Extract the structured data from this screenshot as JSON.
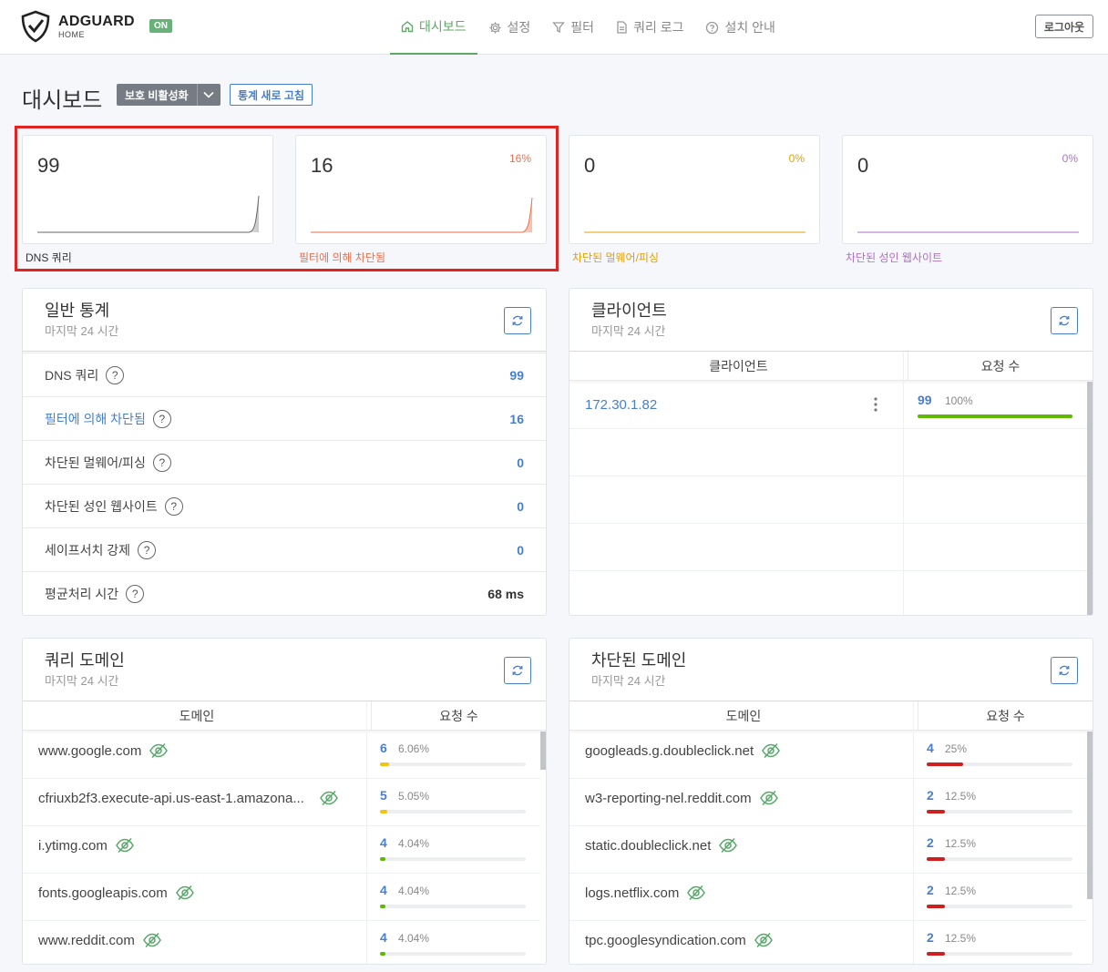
{
  "header": {
    "logo_name": "ADGUARD",
    "logo_sub": "HOME",
    "status_badge": "ON",
    "nav": [
      {
        "label": "대시보드",
        "icon": "home-icon"
      },
      {
        "label": "설정",
        "icon": "gear-icon"
      },
      {
        "label": "필터",
        "icon": "filter-icon"
      },
      {
        "label": "쿼리 로그",
        "icon": "document-icon"
      },
      {
        "label": "설치 안내",
        "icon": "help-circle-icon"
      }
    ],
    "logout": "로그아웃"
  },
  "title": {
    "text": "대시보드",
    "protect_button": "보호 비활성화",
    "refresh_stats": "통계 새로 고침"
  },
  "stats": [
    {
      "value": "99",
      "percent": "",
      "label": "DNS 쿼리",
      "color": "#666666"
    },
    {
      "value": "16",
      "percent": "16%",
      "label": "필터에 의해 차단됨",
      "color": "#ef6d4a"
    },
    {
      "value": "0",
      "percent": "0%",
      "label": "차단된 멀웨어/피싱",
      "color": "#e3a000"
    },
    {
      "value": "0",
      "percent": "0%",
      "label": "차단된 성인 웹사이트",
      "color": "#b26ec9"
    }
  ],
  "general": {
    "title": "일반 통계",
    "subtitle": "마지막 24 시간",
    "rows": [
      {
        "label": "DNS 쿼리",
        "value": "99"
      },
      {
        "label": "필터에 의해 차단됨",
        "value": "16"
      },
      {
        "label": "차단된 멀웨어/피싱",
        "value": "0"
      },
      {
        "label": "차단된 성인 웹사이트",
        "value": "0"
      },
      {
        "label": "세이프서치 강제",
        "value": "0"
      },
      {
        "label": "평균처리 시간",
        "value": "68 ms"
      }
    ]
  },
  "clients": {
    "title": "클라이언트",
    "subtitle": "마지막 24 시간",
    "col_client": "클라이언트",
    "col_requests": "요청 수",
    "rows": [
      {
        "ip": "172.30.1.82",
        "count": "99",
        "percent": "100%",
        "fill": 1.0
      }
    ]
  },
  "query_domains": {
    "title": "쿼리 도메인",
    "subtitle": "마지막 24 시간",
    "col_domain": "도메인",
    "col_requests": "요청 수",
    "rows": [
      {
        "domain": "www.google.com",
        "count": "6",
        "percent": "6.06%",
        "fill": 0.0606,
        "color": "#f1c40f"
      },
      {
        "domain": "cfriuxb2f3.execute-api.us-east-1.amazona...",
        "count": "5",
        "percent": "5.05%",
        "fill": 0.0505,
        "color": "#f1c40f"
      },
      {
        "domain": "i.ytimg.com",
        "count": "4",
        "percent": "4.04%",
        "fill": 0.0404,
        "color": "#5eba00"
      },
      {
        "domain": "fonts.googleapis.com",
        "count": "4",
        "percent": "4.04%",
        "fill": 0.0404,
        "color": "#5eba00"
      },
      {
        "domain": "www.reddit.com",
        "count": "4",
        "percent": "4.04%",
        "fill": 0.0404,
        "color": "#5eba00"
      }
    ]
  },
  "blocked_domains": {
    "title": "차단된 도메인",
    "subtitle": "마지막 24 시간",
    "col_domain": "도메인",
    "col_requests": "요청 수",
    "rows": [
      {
        "domain": "googleads.g.doubleclick.net",
        "count": "4",
        "percent": "25%",
        "fill": 0.25,
        "color": "#cd201f"
      },
      {
        "domain": "w3-reporting-nel.reddit.com",
        "count": "2",
        "percent": "12.5%",
        "fill": 0.125,
        "color": "#cd201f"
      },
      {
        "domain": "static.doubleclick.net",
        "count": "2",
        "percent": "12.5%",
        "fill": 0.125,
        "color": "#cd201f"
      },
      {
        "domain": "logs.netflix.com",
        "count": "2",
        "percent": "12.5%",
        "fill": 0.125,
        "color": "#cd201f"
      },
      {
        "domain": "tpc.googlesyndication.com",
        "count": "2",
        "percent": "12.5%",
        "fill": 0.125,
        "color": "#cd201f"
      }
    ]
  }
}
